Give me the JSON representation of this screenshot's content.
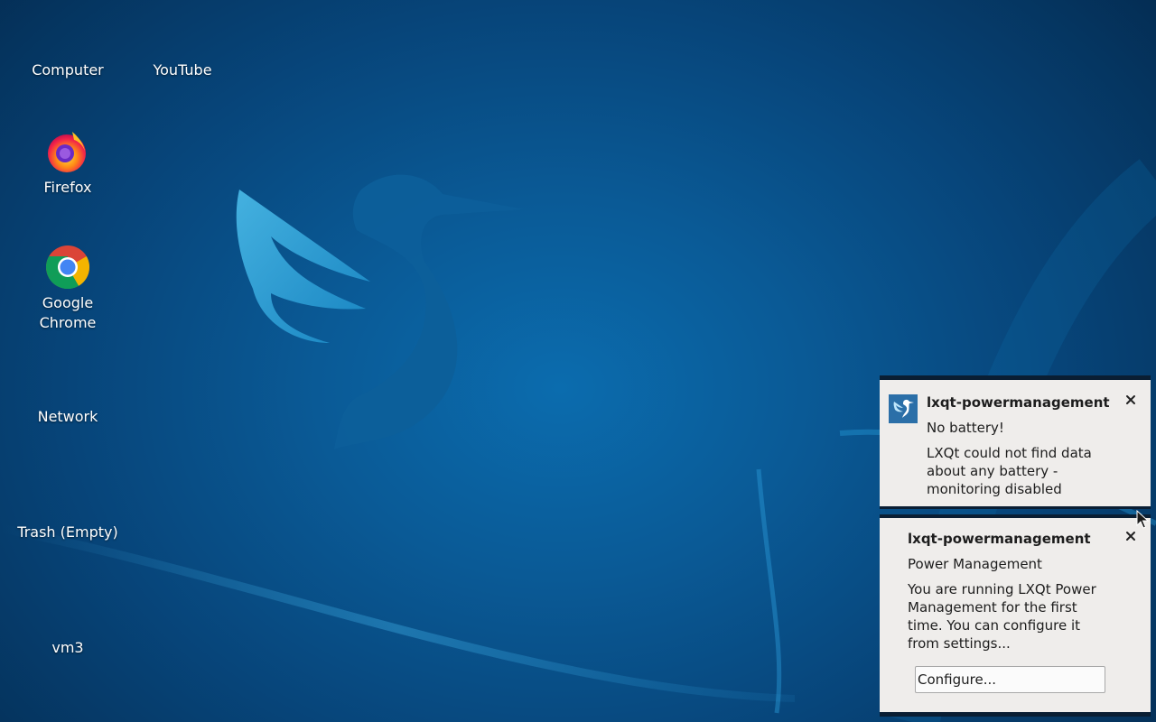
{
  "desktop": {
    "icons": [
      {
        "label": "Computer",
        "icon": "computer-icon"
      },
      {
        "label": "YouTube",
        "icon": "youtube-icon"
      },
      {
        "label": "Firefox",
        "icon": "firefox-icon"
      },
      {
        "label": "Google Chrome",
        "icon": "chrome-icon"
      },
      {
        "label": "Network",
        "icon": "network-icon"
      },
      {
        "label": "Trash (Empty)",
        "icon": "trash-icon"
      },
      {
        "label": "vm3",
        "icon": "drive-icon"
      }
    ]
  },
  "notifications": [
    {
      "app": "lxqt-powermanagement",
      "summary": "No battery!",
      "body": "LXQt could not find data about any battery - monitoring disabled",
      "has_icon": true
    },
    {
      "app": "lxqt-powermanagement",
      "summary": "Power Management",
      "body": "You are running LXQt Power Management for the first time. You can configure it from settings...",
      "action_label": "Configure..."
    }
  ],
  "colors": {
    "wallpaper": "#0a5a96",
    "notification_bg": "#efedeb",
    "notification_border": "#0a1e33"
  }
}
